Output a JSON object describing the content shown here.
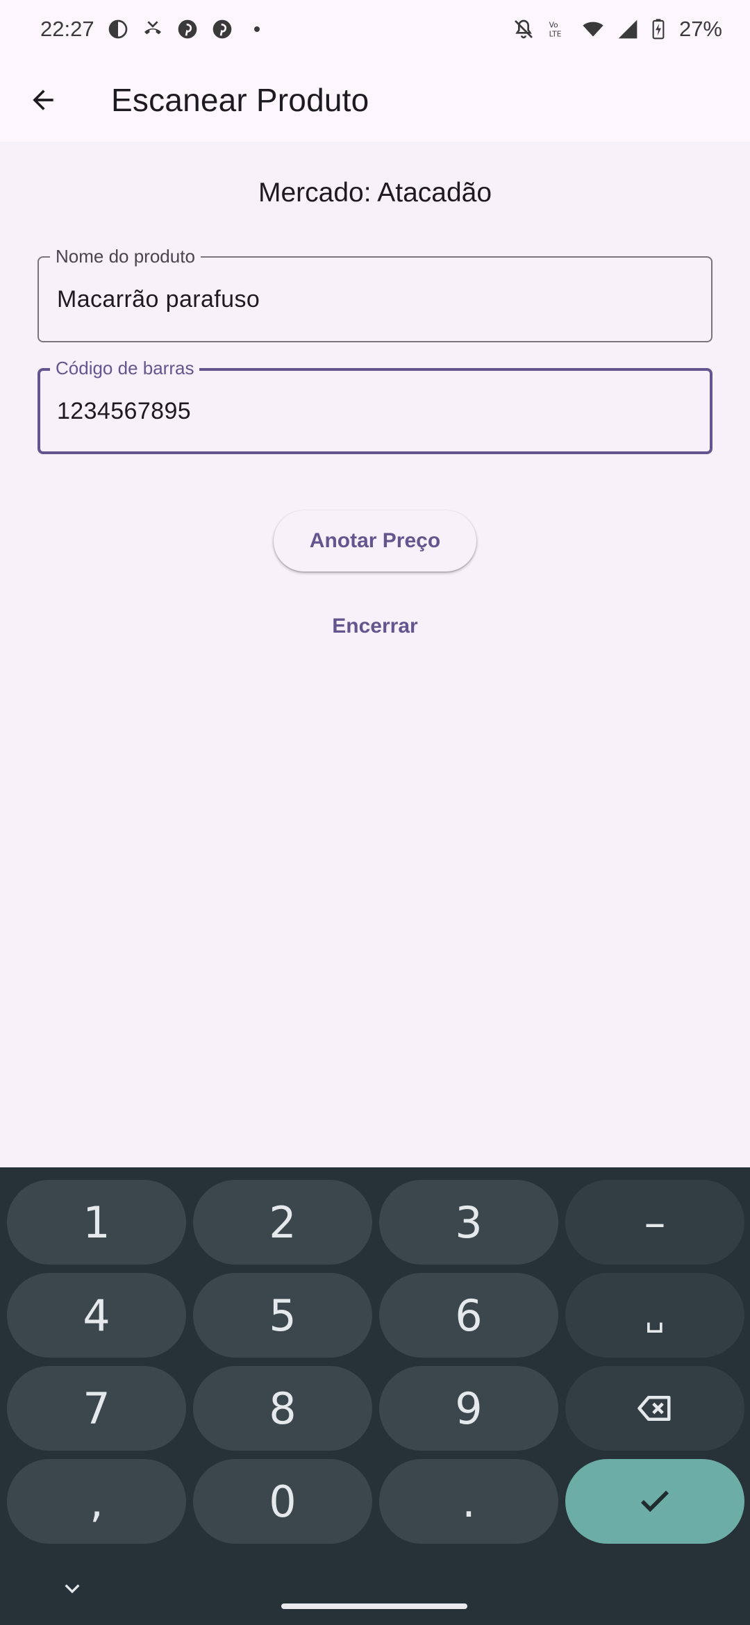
{
  "status_bar": {
    "time": "22:27",
    "battery": "27%",
    "icons": [
      "app-icon",
      "missed-call-icon",
      "pinterest-icon",
      "pinterest-icon",
      "dot-icon",
      "bell-off-icon",
      "volte-icon",
      "wifi-icon",
      "signal-icon",
      "battery-charging-icon"
    ]
  },
  "app_bar": {
    "title": "Escanear Produto"
  },
  "main": {
    "market_label": "Mercado: Atacadão",
    "product_name": {
      "label": "Nome do produto",
      "value": "Macarrão parafuso"
    },
    "barcode": {
      "label": "Código de barras",
      "value": "1234567895"
    },
    "anotar_button": "Anotar Preço",
    "encerrar_button": "Encerrar"
  },
  "keyboard": {
    "keys": {
      "k1": "1",
      "k2": "2",
      "k3": "3",
      "dash": "–",
      "k4": "4",
      "k5": "5",
      "k6": "6",
      "space": "␣",
      "k7": "7",
      "k8": "8",
      "k9": "9",
      "comma": ",",
      "k0": "0",
      "period": "."
    }
  },
  "colors": {
    "accent": "#65558f",
    "background": "#f7f2f9",
    "keyboard_bg": "#263238",
    "key_bg": "#3b464d",
    "enter_key": "#6cada5"
  }
}
